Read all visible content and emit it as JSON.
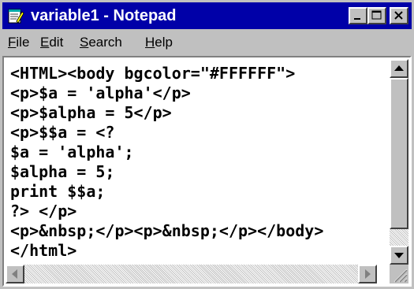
{
  "window": {
    "title": "variable1 - Notepad",
    "title_bar_color": "#0000a8",
    "icons": {
      "app": "notepad-icon",
      "minimize": "minimize-icon",
      "maximize": "maximize-icon",
      "close": "close-icon"
    }
  },
  "menu": {
    "items": [
      {
        "key": "F",
        "rest": "ile"
      },
      {
        "key": "E",
        "rest": "dit"
      },
      {
        "key": "S",
        "rest": "earch"
      },
      {
        "key": "H",
        "rest": "elp"
      }
    ]
  },
  "editor": {
    "lines": [
      "<HTML><body bgcolor=\"#FFFFFF\">",
      "<p>$a = 'alpha'</p>",
      "<p>$alpha = 5</p>",
      "<p>$$a = <?",
      "$a = 'alpha';",
      "$alpha = 5;",
      "print $$a;",
      "?> </p>",
      "<p>&nbsp;</p><p>&nbsp;</p></body>",
      "</html>"
    ]
  }
}
